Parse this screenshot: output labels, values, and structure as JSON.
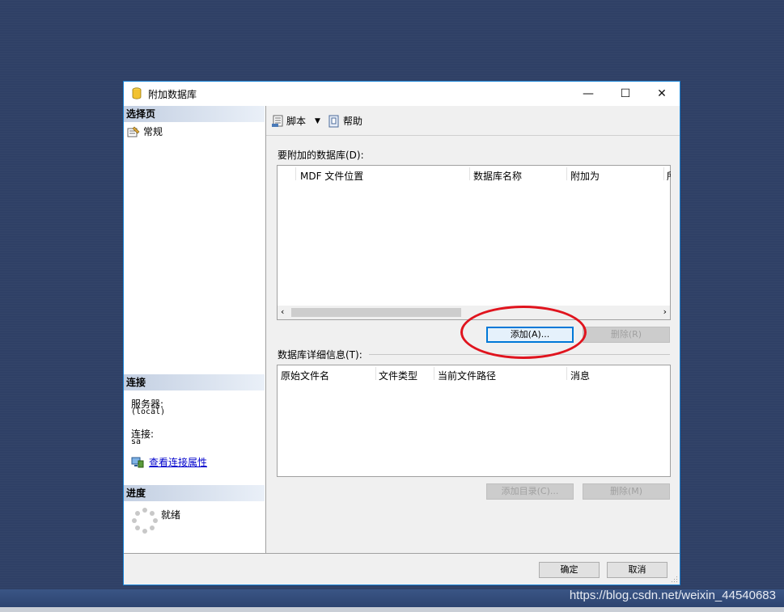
{
  "dialog": {
    "title": "附加数据库",
    "minimize": "—",
    "maximize": "☐",
    "close": "✕"
  },
  "left": {
    "select_page_header": "选择页",
    "pages": [
      {
        "label": "常规"
      }
    ],
    "connection_header": "连接",
    "server_label": "服务器:",
    "server_value": "(local)",
    "connection_label": "连接:",
    "connection_value": "sa",
    "view_props_link": "查看连接属性",
    "progress_header": "进度",
    "progress_status": "就绪"
  },
  "toolbar": {
    "script_label": "脚本",
    "help_label": "帮助"
  },
  "attach": {
    "label": "要附加的数据库(D):",
    "columns": [
      "MDF 文件位置",
      "数据库名称",
      "附加为",
      "所"
    ],
    "add_button": "添加(A)...",
    "remove_button": "删除(R)"
  },
  "details": {
    "label": "数据库详细信息(T):",
    "columns": [
      "原始文件名",
      "文件类型",
      "当前文件路径",
      "消息"
    ],
    "add_catalog_button": "添加目录(C)...",
    "remove_button": "删除(M)"
  },
  "footer": {
    "ok_button": "确定",
    "cancel_button": "取消"
  },
  "watermark": "https://blog.csdn.net/weixin_44540683",
  "colors": {
    "desktop": "#2f4066",
    "dialog_border": "#1883d7",
    "highlight_ellipse": "#e0141e"
  }
}
